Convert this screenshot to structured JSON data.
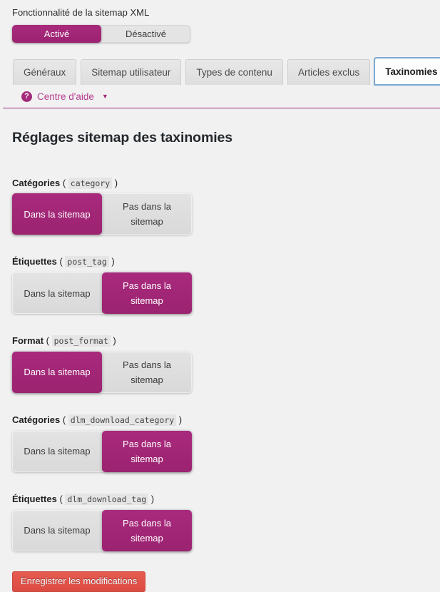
{
  "colors": {
    "accent_magenta": "#a42a7b",
    "page_bg": "#f1f1f1",
    "toggle_off_bg": "#dedede",
    "save_button_bg": "#e2564c",
    "tab_active_outline": "#7aa9d4"
  },
  "feature": {
    "label": "Fonctionnalité de la sitemap XML",
    "options": [
      {
        "label": "Activé",
        "state": "on"
      },
      {
        "label": "Désactivé",
        "state": "off"
      }
    ]
  },
  "tabs": [
    {
      "label": "Généraux",
      "active": false
    },
    {
      "label": "Sitemap utilisateur",
      "active": false
    },
    {
      "label": "Types de contenu",
      "active": false
    },
    {
      "label": "Articles exclus",
      "active": false
    },
    {
      "label": "Taxinomies",
      "active": true
    }
  ],
  "help": {
    "icon": "question-mark-circle-icon",
    "label": "Centre d'aide",
    "caret": "▼"
  },
  "main": {
    "title": "Réglages sitemap des taxinomies",
    "option_in": "Dans la sitemap",
    "option_out": "Pas dans la sitemap",
    "taxonomies": [
      {
        "name": "Catégories",
        "slug": "category",
        "selected": "in"
      },
      {
        "name": "Étiquettes",
        "slug": "post_tag",
        "selected": "out"
      },
      {
        "name": "Format",
        "slug": "post_format",
        "selected": "in"
      },
      {
        "name": "Catégories",
        "slug": "dlm_download_category",
        "selected": "out"
      },
      {
        "name": "Étiquettes",
        "slug": "dlm_download_tag",
        "selected": "out"
      }
    ]
  },
  "submit": {
    "label": "Enregistrer les modifications"
  }
}
